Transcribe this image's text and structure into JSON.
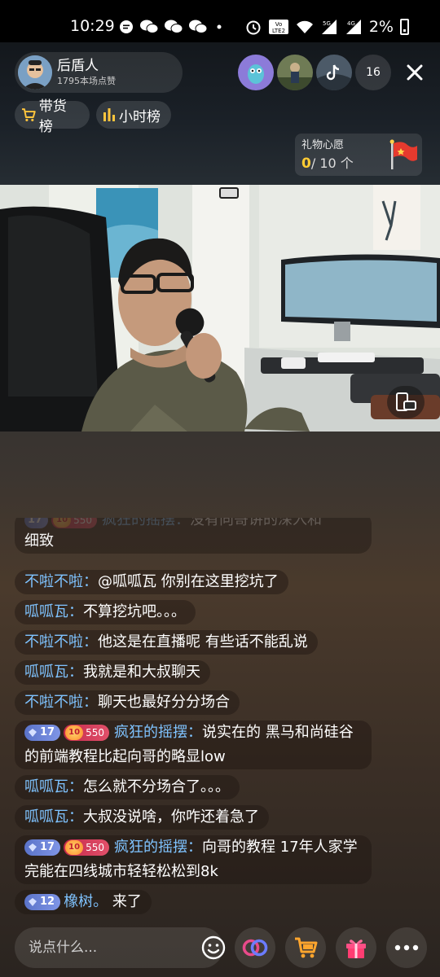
{
  "status_bar": {
    "time": "10:29",
    "battery": "2%",
    "network_5g": "5G",
    "network_4g": "4G",
    "volte": "Vo LTE2"
  },
  "host": {
    "name": "后盾人",
    "likes": "1795本场点赞"
  },
  "viewer_count": "16",
  "rank_buttons": {
    "goods": "带货榜",
    "hour": "小时榜"
  },
  "wish": {
    "title": "礼物心愿",
    "current": "0",
    "total": "/ 10 个"
  },
  "chat": {
    "partial_line": "细致",
    "messages": [
      {
        "user": "不啦不啦：",
        "text": "@呱呱瓦 你别在这里挖坑了"
      },
      {
        "user": "呱呱瓦：",
        "text": "不算挖坑吧。。。"
      },
      {
        "user": "不啦不啦：",
        "text": "他这是在直播呢 有些话不能乱说"
      },
      {
        "user": "呱呱瓦：",
        "text": "我就是和大叔聊天"
      },
      {
        "user": "不啦不啦：",
        "text": "聊天也最好分分场合"
      },
      {
        "level": "17",
        "fan_level": "10",
        "fan_score": "550",
        "user": "疯狂的摇摆：",
        "text": "说实在的 黑马和尚硅谷的前端教程比起向哥的略显low"
      },
      {
        "user": "呱呱瓦：",
        "text": "怎么就不分场合了。。。"
      },
      {
        "user": "呱呱瓦：",
        "text": "大叔没说啥，你咋还着急了"
      },
      {
        "level": "17",
        "fan_level": "10",
        "fan_score": "550",
        "user": "疯狂的摇摆：",
        "text": "向哥的教程 17年人家学完能在四线城市轻轻松松到8k"
      },
      {
        "level": "12",
        "user": "橡树。",
        "text": "来了"
      }
    ]
  },
  "input": {
    "placeholder": "说点什么..."
  },
  "colors": {
    "username": "#7fc3ff",
    "wish_accent": "#ffcc33",
    "level_badge": "#6a82d6",
    "fan_badge": "#d63a5a"
  }
}
